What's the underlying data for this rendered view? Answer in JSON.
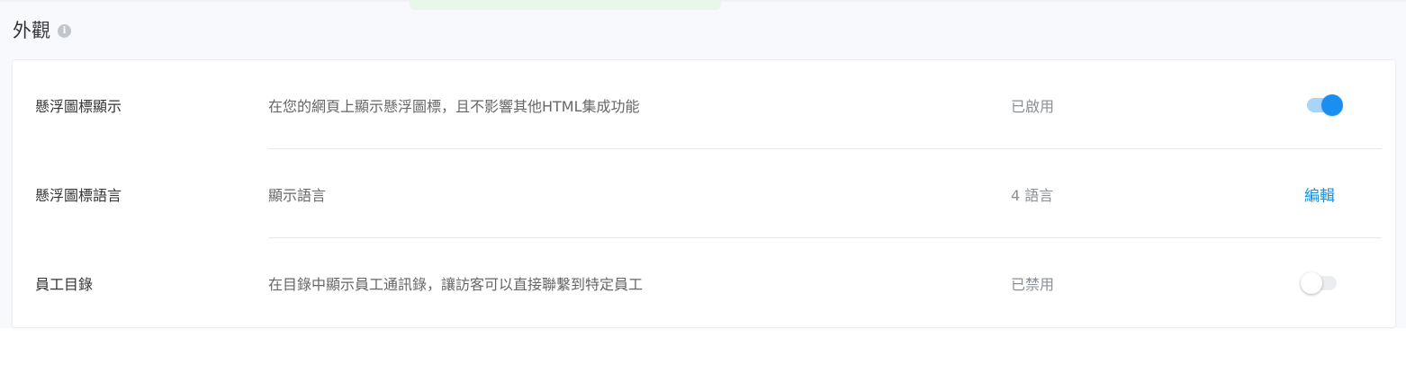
{
  "section": {
    "title": "外觀",
    "info_icon": "info-icon"
  },
  "rows": [
    {
      "label": "懸浮圖標顯示",
      "description": "在您的網頁上顯示懸浮圖標，且不影響其他HTML集成功能",
      "status": "已啟用",
      "control": "toggle",
      "enabled": true
    },
    {
      "label": "懸浮圖標語言",
      "description": "顯示語言",
      "status": "4 語言",
      "control": "link",
      "action_label": "編輯"
    },
    {
      "label": "員工目錄",
      "description": "在目錄中顯示員工通訊錄，讓訪客可以直接聯繫到特定員工",
      "status": "已禁用",
      "control": "toggle",
      "enabled": false
    }
  ],
  "colors": {
    "accent": "#1b8ff0",
    "link": "#1a8fd9",
    "toggle_on_track": "#a9d3f7",
    "toggle_off_track": "#ebedf0"
  }
}
